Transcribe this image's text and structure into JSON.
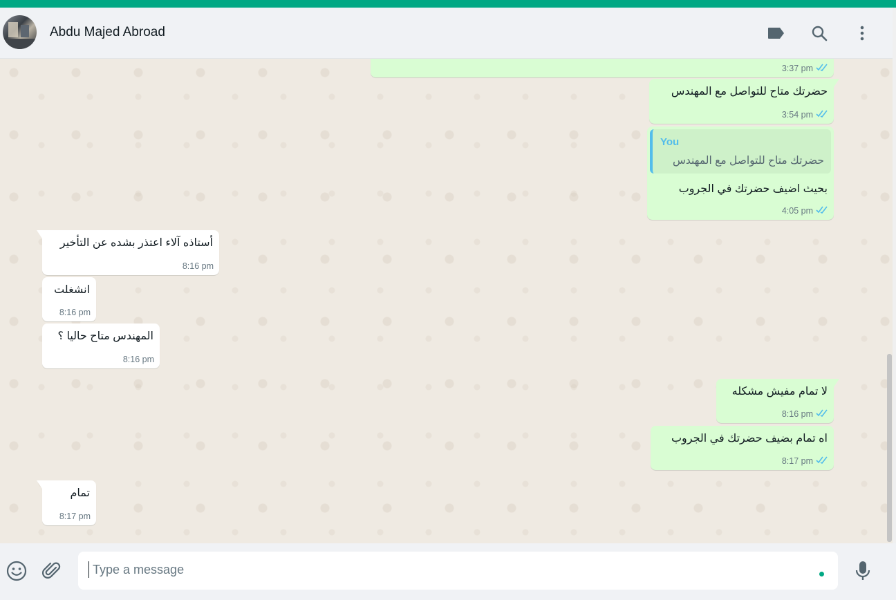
{
  "header": {
    "contact_name": "Abdu Majed Abroad"
  },
  "messages": [
    {
      "id": "m1",
      "direction": "out",
      "text": "",
      "time": "3:37 pm",
      "status": "read"
    },
    {
      "id": "m2",
      "direction": "out",
      "text": "حضرتك متاح للتواصل مع المهندس",
      "time": "3:54 pm",
      "status": "read"
    },
    {
      "id": "m3",
      "direction": "out",
      "quote_author": "You",
      "quote_text": "حضرتك متاح للتواصل مع المهندس",
      "text": "بحيث اضيف حضرتك في الجروب",
      "time": "4:05 pm",
      "status": "read"
    },
    {
      "id": "m4",
      "direction": "in",
      "text": "أستاذه آلاء اعتذر بشده عن التأخير",
      "time": "8:16 pm"
    },
    {
      "id": "m5",
      "direction": "in",
      "text": "انشغلت",
      "time": "8:16 pm"
    },
    {
      "id": "m6",
      "direction": "in",
      "text": "المهندس متاح حاليا ؟",
      "time": "8:16 pm"
    },
    {
      "id": "m7",
      "direction": "out",
      "text": "لا تمام مفيش مشكله",
      "time": "8:16 pm",
      "status": "read"
    },
    {
      "id": "m8",
      "direction": "out",
      "text": "اه تمام بضيف حضرتك في الجروب",
      "time": "8:17 pm",
      "status": "read"
    },
    {
      "id": "m9",
      "direction": "in",
      "text": "تمام",
      "time": "8:17 pm"
    }
  ],
  "composer": {
    "placeholder": "Type a message"
  },
  "colors": {
    "accent": "#00a884",
    "outgoing_bubble": "#d9fdd3",
    "incoming_bubble": "#ffffff",
    "read_ticks": "#53bdeb"
  },
  "icons": [
    "label-icon",
    "search-icon",
    "menu-icon",
    "emoji-icon",
    "attach-icon",
    "mic-icon",
    "double-check-icon"
  ]
}
